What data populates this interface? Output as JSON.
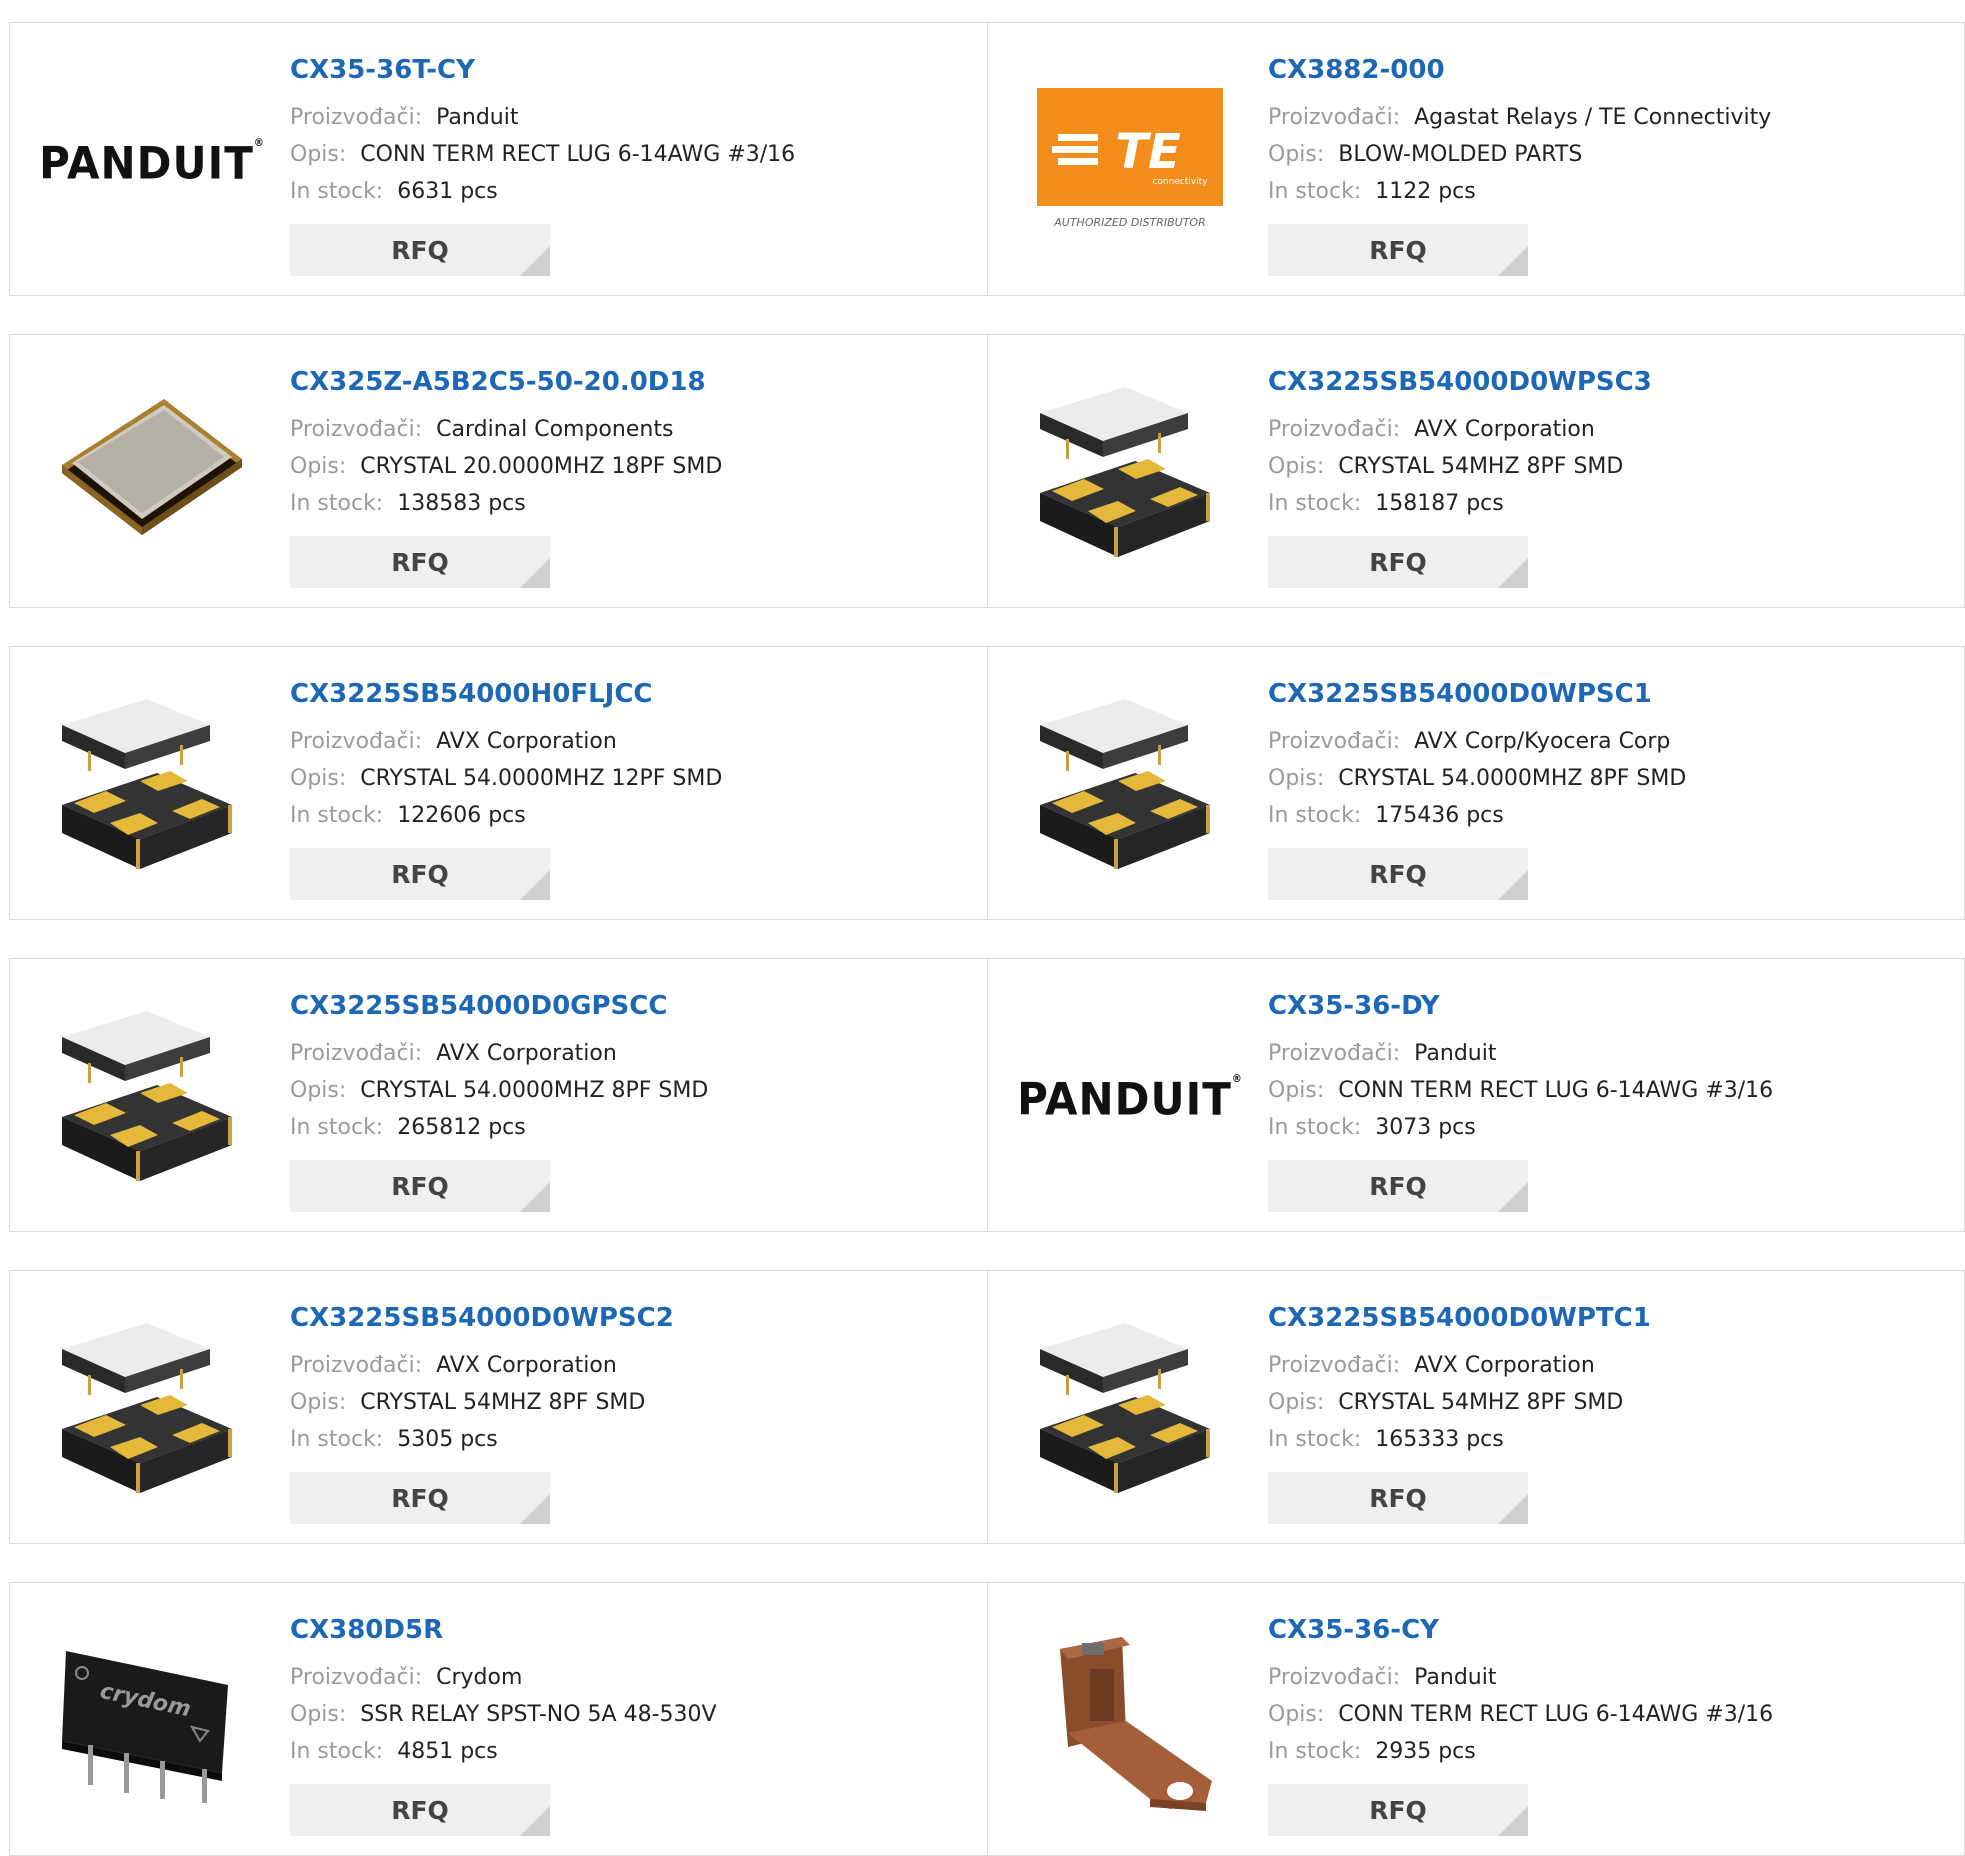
{
  "labels": {
    "manufacturer": "Proizvođači:",
    "description": "Opis:",
    "stock": "In stock:",
    "rfq": "RFQ"
  },
  "products": [
    {
      "pn": "CX35-36T-CY",
      "manufacturer": "Panduit",
      "description": "CONN TERM RECT LUG 6-14AWG #3/16",
      "stock": "6631 pcs",
      "image": "panduit-logo"
    },
    {
      "pn": "CX3882-000",
      "manufacturer": "Agastat Relays / TE Connectivity",
      "description": "BLOW-MOLDED PARTS",
      "stock": "1122 pcs",
      "image": "te-logo"
    },
    {
      "pn": "CX325Z-A5B2C5-50-20.0D18",
      "manufacturer": "Cardinal Components",
      "description": "CRYSTAL 20.0000MHZ 18PF SMD",
      "stock": "138583 pcs",
      "image": "crystal-metal"
    },
    {
      "pn": "CX3225SB54000D0WPSC3",
      "manufacturer": "AVX Corporation",
      "description": "CRYSTAL 54MHZ 8PF SMD",
      "stock": "158187 pcs",
      "image": "crystal-smd"
    },
    {
      "pn": "CX3225SB54000H0FLJCC",
      "manufacturer": "AVX Corporation",
      "description": "CRYSTAL 54.0000MHZ 12PF SMD",
      "stock": "122606 pcs",
      "image": "crystal-smd"
    },
    {
      "pn": "CX3225SB54000D0WPSC1",
      "manufacturer": "AVX Corp/Kyocera Corp",
      "description": "CRYSTAL 54.0000MHZ 8PF SMD",
      "stock": "175436 pcs",
      "image": "crystal-smd"
    },
    {
      "pn": "CX3225SB54000D0GPSCC",
      "manufacturer": "AVX Corporation",
      "description": "CRYSTAL 54.0000MHZ 8PF SMD",
      "stock": "265812 pcs",
      "image": "crystal-smd"
    },
    {
      "pn": "CX35-36-DY",
      "manufacturer": "Panduit",
      "description": "CONN TERM RECT LUG 6-14AWG #3/16",
      "stock": "3073 pcs",
      "image": "panduit-logo"
    },
    {
      "pn": "CX3225SB54000D0WPSC2",
      "manufacturer": "AVX Corporation",
      "description": "CRYSTAL 54MHZ 8PF SMD",
      "stock": "5305 pcs",
      "image": "crystal-smd"
    },
    {
      "pn": "CX3225SB54000D0WPTC1",
      "manufacturer": "AVX Corporation",
      "description": "CRYSTAL 54MHZ 8PF SMD",
      "stock": "165333 pcs",
      "image": "crystal-smd"
    },
    {
      "pn": "CX380D5R",
      "manufacturer": "Crydom",
      "description": "SSR RELAY SPST-NO 5A 48-530V",
      "stock": "4851 pcs",
      "image": "crydom-relay"
    },
    {
      "pn": "CX35-36-CY",
      "manufacturer": "Panduit",
      "description": "CONN TERM RECT LUG 6-14AWG #3/16",
      "stock": "2935 pcs",
      "image": "copper-lug"
    }
  ],
  "logos": {
    "panduit": "PANDUIT",
    "te_brand": "TE",
    "te_sub": "connectivity",
    "te_distributor": "AUTHORIZED DISTRIBUTOR",
    "crydom": "crydom"
  },
  "colors": {
    "part_link": "#1d67b4",
    "te_orange": "#f28d1b",
    "rfq_bg": "#efefef"
  }
}
